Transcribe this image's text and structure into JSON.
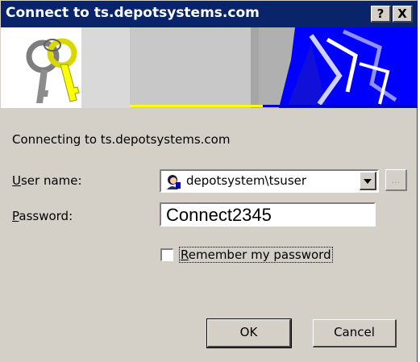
{
  "window": {
    "title": "Connect to ts.depotsystems.com"
  },
  "titlebar": {
    "help_label": "?",
    "close_label": "X"
  },
  "banner": {
    "colors": {
      "bg": "#ffffff",
      "gray": "#bdbdbd",
      "blue": "#0000ff",
      "yellow": "#ffff00"
    }
  },
  "message": "Connecting to ts.depotsystems.com",
  "fields": {
    "username": {
      "label_accesskey": "U",
      "label_rest": "ser name:",
      "value": "depotsystem\\tsuser",
      "browse_label": "..."
    },
    "password": {
      "label_accesskey": "P",
      "label_rest": "assword:",
      "value": "Connect2345"
    },
    "remember": {
      "label_accesskey": "R",
      "label_rest": "emember my password",
      "checked": false
    }
  },
  "buttons": {
    "ok": "OK",
    "cancel": "Cancel"
  },
  "icons": {
    "keys": "keys-icon",
    "user": "user-account-icon",
    "dropdown": "chevron-down-icon"
  }
}
